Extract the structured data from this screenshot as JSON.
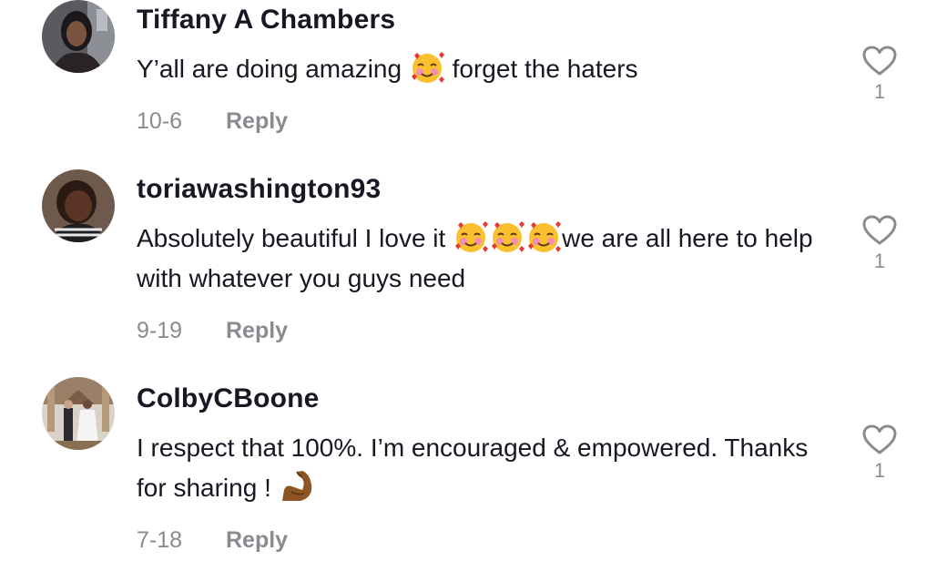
{
  "comments": [
    {
      "username": "Tiffany A Chambers",
      "text_before": "Y’all are doing amazing ",
      "text_after": " forget the haters",
      "emojis": [
        "smiling-face-with-hearts-emoji"
      ],
      "date": "10-6",
      "reply_label": "Reply",
      "likes": "1",
      "avatar": "user-avatar-photo"
    },
    {
      "username": "toriawashington93",
      "text_before": "Absolutely beautiful I love it ",
      "text_after": "we are all here to help with whatever you guys need",
      "emojis": [
        "smiling-face-with-hearts-emoji",
        "smiling-face-with-hearts-emoji",
        "smiling-face-with-hearts-emoji"
      ],
      "date": "9-19",
      "reply_label": "Reply",
      "likes": "1",
      "avatar": "user-avatar-photo"
    },
    {
      "username": "ColbyCBoone",
      "text_before": "I respect that 100%. I’m encouraged & empowered. Thanks for sharing ! ",
      "text_after": "",
      "emojis": [
        "flexed-biceps-emoji"
      ],
      "date": "7-18",
      "reply_label": "Reply",
      "likes": "1",
      "avatar": "wedding-photo-avatar"
    }
  ],
  "colors": {
    "text": "#161823",
    "muted": "#8a8b91",
    "background": "#ffffff"
  }
}
